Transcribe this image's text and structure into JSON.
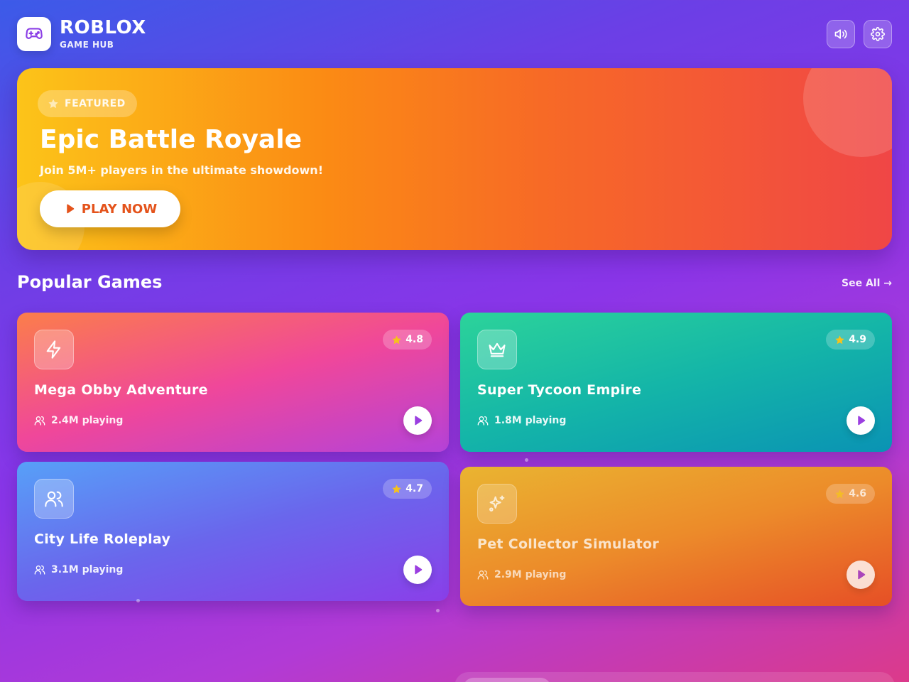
{
  "brand": {
    "title": "ROBLOX",
    "subtitle": "GAME HUB"
  },
  "header_icons": [
    "gamepad-icon",
    "volume-icon",
    "gear-icon"
  ],
  "hero": {
    "badge": "FEATURED",
    "title": "Epic Battle Royale",
    "subtitle": "Join 5M+ players in the ultimate showdown!",
    "cta": "PLAY NOW"
  },
  "section": {
    "title": "Popular Games",
    "see_all": "See All →"
  },
  "games": [
    {
      "title": "Mega Obby Adventure",
      "rating": "4.8",
      "players": "2.4M playing",
      "icon": "lightning-icon"
    },
    {
      "title": "Super Tycoon Empire",
      "rating": "4.9",
      "players": "1.8M playing",
      "icon": "crown-icon"
    },
    {
      "title": "City Life Roleplay",
      "rating": "4.7",
      "players": "3.1M playing",
      "icon": "users-icon"
    },
    {
      "title": "Pet Collector Simulator",
      "rating": "4.6",
      "players": "2.9M playing",
      "icon": "sparkles-icon"
    }
  ],
  "colors": {
    "accent": "#e4531b",
    "play_icon": "#9b3fe0",
    "star": "#f6c21c"
  }
}
